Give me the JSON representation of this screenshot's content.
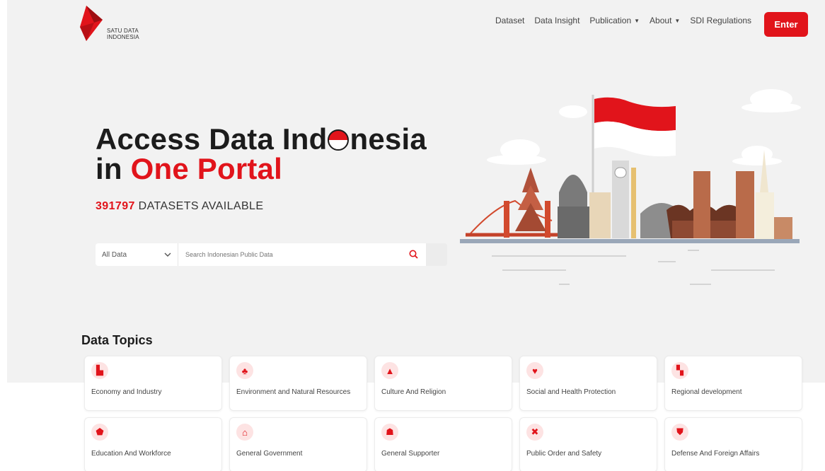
{
  "brand": {
    "line1": "SATU DATA",
    "line2": "INDONESIA",
    "accent": "#e1141b"
  },
  "nav": {
    "items": [
      {
        "label": "Dataset",
        "dropdown": false
      },
      {
        "label": "Data Insight",
        "dropdown": false
      },
      {
        "label": "Publication",
        "dropdown": true
      },
      {
        "label": "About",
        "dropdown": true
      },
      {
        "label": "SDI Regulations",
        "dropdown": false
      }
    ],
    "enter_label": "Enter"
  },
  "hero": {
    "line1_a": "Access Data Ind",
    "line1_b": "nesia",
    "line2_a": "in ",
    "line2_b": "One Portal",
    "dataset_count": "391797",
    "dataset_suffix": "DATASETS AVAILABLE"
  },
  "search": {
    "filter_value": "All Data",
    "placeholder": "Search Indonesian Public Data"
  },
  "topics": {
    "title": "Data Topics",
    "items": [
      {
        "label": "Economy and Industry",
        "icon": "factory-icon",
        "glyph": "▙"
      },
      {
        "label": "Environment and Natural Resources",
        "icon": "tree-icon",
        "glyph": "♣"
      },
      {
        "label": "Culture And Religion",
        "icon": "temple-icon",
        "glyph": "▲"
      },
      {
        "label": "Social and Health Protection",
        "icon": "heart-hand-icon",
        "glyph": "♥"
      },
      {
        "label": "Regional development",
        "icon": "building-icon",
        "glyph": "▚"
      },
      {
        "label": "Education And Workforce",
        "icon": "graduation-cap-icon",
        "glyph": "⬟"
      },
      {
        "label": "General Government",
        "icon": "government-building-icon",
        "glyph": "⌂"
      },
      {
        "label": "General Supporter",
        "icon": "people-icon",
        "glyph": "☗"
      },
      {
        "label": "Public Order and Safety",
        "icon": "handcuffs-icon",
        "glyph": "✖"
      },
      {
        "label": "Defense And Foreign Affairs",
        "icon": "shield-icon",
        "glyph": "⛊"
      }
    ]
  }
}
